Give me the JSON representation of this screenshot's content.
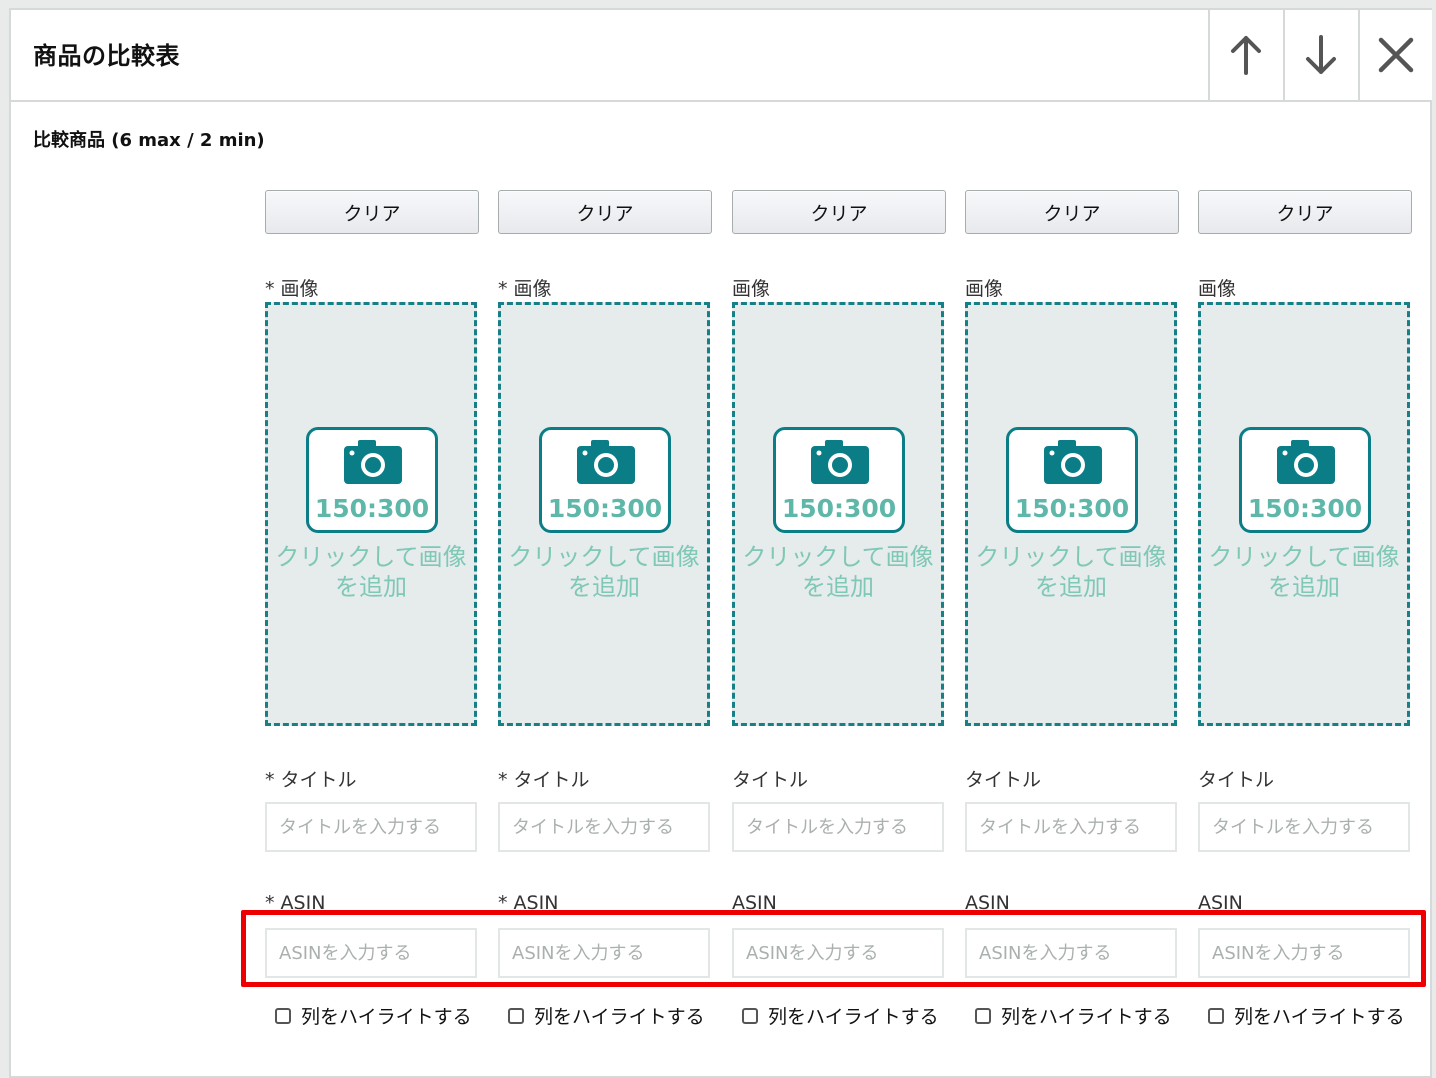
{
  "header": {
    "title": "商品の比較表"
  },
  "section": {
    "label": "比較商品 (6 max / 2 min)"
  },
  "columns": [
    {
      "clear_label": "クリア",
      "image_label": "* 画像",
      "ratio": "150:300",
      "add_image_text": "クリックして画像を追加",
      "title_label": "* タイトル",
      "title_placeholder": "タイトルを入力する",
      "asin_label": "* ASIN",
      "asin_placeholder": "ASINを入力する",
      "highlight_label": "列をハイライトする"
    },
    {
      "clear_label": "クリア",
      "image_label": "* 画像",
      "ratio": "150:300",
      "add_image_text": "クリックして画像を追加",
      "title_label": "* タイトル",
      "title_placeholder": "タイトルを入力する",
      "asin_label": "* ASIN",
      "asin_placeholder": "ASINを入力する",
      "highlight_label": "列をハイライトする"
    },
    {
      "clear_label": "クリア",
      "image_label": "画像",
      "ratio": "150:300",
      "add_image_text": "クリックして画像を追加",
      "title_label": "タイトル",
      "title_placeholder": "タイトルを入力する",
      "asin_label": "ASIN",
      "asin_placeholder": "ASINを入力する",
      "highlight_label": "列をハイライトする"
    },
    {
      "clear_label": "クリア",
      "image_label": "画像",
      "ratio": "150:300",
      "add_image_text": "クリックして画像を追加",
      "title_label": "タイトル",
      "title_placeholder": "タイトルを入力する",
      "asin_label": "ASIN",
      "asin_placeholder": "ASINを入力する",
      "highlight_label": "列をハイライトする"
    },
    {
      "clear_label": "クリア",
      "image_label": "画像",
      "ratio": "150:300",
      "add_image_text": "クリックして画像を追加",
      "title_label": "タイトル",
      "title_placeholder": "タイトルを入力する",
      "asin_label": "ASIN",
      "asin_placeholder": "ASINを入力する",
      "highlight_label": "列をハイライトする"
    }
  ],
  "icons": {
    "move_up": "arrow-up-icon",
    "move_down": "arrow-down-icon",
    "close": "close-icon",
    "camera": "camera-icon"
  },
  "colors": {
    "accent": "#0a7d86",
    "placeholder_text": "#7fc8b5",
    "annotation": "#ee0000"
  }
}
